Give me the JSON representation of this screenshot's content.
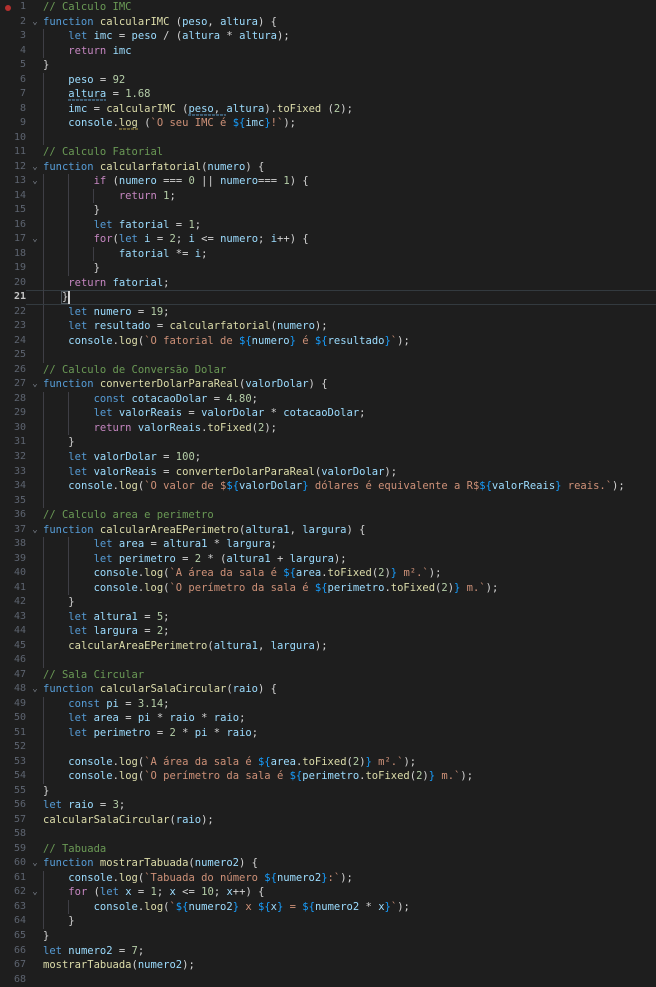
{
  "editor": {
    "language": "javascript",
    "theme": "dark-plus",
    "background_color": "#1e1e1e",
    "active_line": 21,
    "breakpoint_line": 1,
    "total_lines_visible": 68,
    "cursor": {
      "line": 21,
      "column": 6
    }
  },
  "icons": {
    "fold_chevron": "chevron-down-icon",
    "breakpoint": "breakpoint-dot-icon"
  },
  "lines": [
    {
      "n": 1,
      "fold": false,
      "indent_guides": 0,
      "text": "// Calculo IMC"
    },
    {
      "n": 2,
      "fold": true,
      "indent_guides": 0,
      "text": "function calcularIMC (peso, altura) {"
    },
    {
      "n": 3,
      "fold": false,
      "indent_guides": 1,
      "text": "    let imc = peso / (altura * altura);"
    },
    {
      "n": 4,
      "fold": false,
      "indent_guides": 1,
      "text": "    return imc"
    },
    {
      "n": 5,
      "fold": false,
      "indent_guides": 0,
      "text": "}"
    },
    {
      "n": 6,
      "fold": false,
      "indent_guides": 1,
      "text": "    peso = 92"
    },
    {
      "n": 7,
      "fold": false,
      "indent_guides": 1,
      "text": "    altura = 1.68"
    },
    {
      "n": 8,
      "fold": false,
      "indent_guides": 1,
      "text": "    imc = calcularIMC (peso, altura).toFixed (2);"
    },
    {
      "n": 9,
      "fold": false,
      "indent_guides": 1,
      "text": "    console.log (`O seu IMC é ${imc}!`);"
    },
    {
      "n": 10,
      "fold": false,
      "indent_guides": 1,
      "text": ""
    },
    {
      "n": 11,
      "fold": false,
      "indent_guides": 0,
      "text": "// Calculo Fatorial"
    },
    {
      "n": 12,
      "fold": true,
      "indent_guides": 0,
      "text": "function calcularfatorial(numero) {"
    },
    {
      "n": 13,
      "fold": true,
      "indent_guides": 2,
      "text": "        if (numero === 0 || numero=== 1) {"
    },
    {
      "n": 14,
      "fold": false,
      "indent_guides": 3,
      "text": "            return 1;"
    },
    {
      "n": 15,
      "fold": false,
      "indent_guides": 2,
      "text": "        }"
    },
    {
      "n": 16,
      "fold": false,
      "indent_guides": 2,
      "text": "        let fatorial = 1;"
    },
    {
      "n": 17,
      "fold": true,
      "indent_guides": 2,
      "text": "        for(let i = 2; i <= numero; i++) {"
    },
    {
      "n": 18,
      "fold": false,
      "indent_guides": 3,
      "text": "            fatorial *= i;"
    },
    {
      "n": 19,
      "fold": false,
      "indent_guides": 2,
      "text": "        }"
    },
    {
      "n": 20,
      "fold": false,
      "indent_guides": 1,
      "text": "    return fatorial;"
    },
    {
      "n": 21,
      "fold": false,
      "indent_guides": 1,
      "text": "   }"
    },
    {
      "n": 22,
      "fold": false,
      "indent_guides": 1,
      "text": "    let numero = 19;"
    },
    {
      "n": 23,
      "fold": false,
      "indent_guides": 1,
      "text": "    let resultado = calcularfatorial(numero);"
    },
    {
      "n": 24,
      "fold": false,
      "indent_guides": 1,
      "text": "    console.log(`O fatorial de ${numero} é ${resultado}`);"
    },
    {
      "n": 25,
      "fold": false,
      "indent_guides": 1,
      "text": ""
    },
    {
      "n": 26,
      "fold": false,
      "indent_guides": 0,
      "text": "// Calculo de Conversão Dolar"
    },
    {
      "n": 27,
      "fold": true,
      "indent_guides": 0,
      "text": "function converterDolarParaReal(valorDolar) {"
    },
    {
      "n": 28,
      "fold": false,
      "indent_guides": 2,
      "text": "        const cotacaoDolar = 4.80;"
    },
    {
      "n": 29,
      "fold": false,
      "indent_guides": 2,
      "text": "        let valorReais = valorDolar * cotacaoDolar;"
    },
    {
      "n": 30,
      "fold": false,
      "indent_guides": 2,
      "text": "        return valorReais.toFixed(2);"
    },
    {
      "n": 31,
      "fold": false,
      "indent_guides": 1,
      "text": "    }"
    },
    {
      "n": 32,
      "fold": false,
      "indent_guides": 1,
      "text": "    let valorDolar = 100;"
    },
    {
      "n": 33,
      "fold": false,
      "indent_guides": 1,
      "text": "    let valorReais = converterDolarParaReal(valorDolar);"
    },
    {
      "n": 34,
      "fold": false,
      "indent_guides": 1,
      "text": "    console.log(`O valor de $${valorDolar} dólares é equivalente a R$${valorReais} reais.`);"
    },
    {
      "n": 35,
      "fold": false,
      "indent_guides": 1,
      "text": ""
    },
    {
      "n": 36,
      "fold": false,
      "indent_guides": 0,
      "text": "// Calculo area e perimetro"
    },
    {
      "n": 37,
      "fold": true,
      "indent_guides": 0,
      "text": "function calcularAreaEPerimetro(altura1, largura) {"
    },
    {
      "n": 38,
      "fold": false,
      "indent_guides": 2,
      "text": "        let area = altura1 * largura;"
    },
    {
      "n": 39,
      "fold": false,
      "indent_guides": 2,
      "text": "        let perimetro = 2 * (altura1 + largura);"
    },
    {
      "n": 40,
      "fold": false,
      "indent_guides": 2,
      "text": "        console.log(`A área da sala é ${area.toFixed(2)} m².`);"
    },
    {
      "n": 41,
      "fold": false,
      "indent_guides": 2,
      "text": "        console.log(`O perímetro da sala é ${perimetro.toFixed(2)} m.`);"
    },
    {
      "n": 42,
      "fold": false,
      "indent_guides": 1,
      "text": "    }"
    },
    {
      "n": 43,
      "fold": false,
      "indent_guides": 1,
      "text": "    let altura1 = 5;"
    },
    {
      "n": 44,
      "fold": false,
      "indent_guides": 1,
      "text": "    let largura = 2;"
    },
    {
      "n": 45,
      "fold": false,
      "indent_guides": 1,
      "text": "    calcularAreaEPerimetro(altura1, largura);"
    },
    {
      "n": 46,
      "fold": false,
      "indent_guides": 1,
      "text": ""
    },
    {
      "n": 47,
      "fold": false,
      "indent_guides": 0,
      "text": "// Sala Circular"
    },
    {
      "n": 48,
      "fold": true,
      "indent_guides": 0,
      "text": "function calcularSalaCircular(raio) {"
    },
    {
      "n": 49,
      "fold": false,
      "indent_guides": 1,
      "text": "    const pi = 3.14;"
    },
    {
      "n": 50,
      "fold": false,
      "indent_guides": 1,
      "text": "    let area = pi * raio * raio;"
    },
    {
      "n": 51,
      "fold": false,
      "indent_guides": 1,
      "text": "    let perimetro = 2 * pi * raio;"
    },
    {
      "n": 52,
      "fold": false,
      "indent_guides": 1,
      "text": ""
    },
    {
      "n": 53,
      "fold": false,
      "indent_guides": 1,
      "text": "    console.log(`A área da sala é ${area.toFixed(2)} m².`);"
    },
    {
      "n": 54,
      "fold": false,
      "indent_guides": 1,
      "text": "    console.log(`O perímetro da sala é ${perimetro.toFixed(2)} m.`);"
    },
    {
      "n": 55,
      "fold": false,
      "indent_guides": 0,
      "text": "}"
    },
    {
      "n": 56,
      "fold": false,
      "indent_guides": 0,
      "text": "let raio = 3;"
    },
    {
      "n": 57,
      "fold": false,
      "indent_guides": 0,
      "text": "calcularSalaCircular(raio);"
    },
    {
      "n": 58,
      "fold": false,
      "indent_guides": 0,
      "text": ""
    },
    {
      "n": 59,
      "fold": false,
      "indent_guides": 0,
      "text": "// Tabuada"
    },
    {
      "n": 60,
      "fold": true,
      "indent_guides": 0,
      "text": "function mostrarTabuada(numero2) {"
    },
    {
      "n": 61,
      "fold": false,
      "indent_guides": 1,
      "text": "    console.log(`Tabuada do número ${numero2}:`);"
    },
    {
      "n": 62,
      "fold": true,
      "indent_guides": 1,
      "text": "    for (let x = 1; x <= 10; x++) {"
    },
    {
      "n": 63,
      "fold": false,
      "indent_guides": 2,
      "text": "        console.log(`${numero2} x ${x} = ${numero2 * x}`);"
    },
    {
      "n": 64,
      "fold": false,
      "indent_guides": 1,
      "text": "    }"
    },
    {
      "n": 65,
      "fold": false,
      "indent_guides": 0,
      "text": "}"
    },
    {
      "n": 66,
      "fold": false,
      "indent_guides": 0,
      "text": "let numero2 = 7;"
    },
    {
      "n": 67,
      "fold": false,
      "indent_guides": 0,
      "text": "mostrarTabuada(numero2);"
    },
    {
      "n": 68,
      "fold": false,
      "indent_guides": 0,
      "text": ""
    }
  ],
  "colors": {
    "background": "#1e1e1e",
    "comment": "#6a9955",
    "keyword": "#569cd6",
    "control_keyword": "#c586c0",
    "function_name": "#dcdcaa",
    "variable": "#9cdcfe",
    "number": "#b5cea8",
    "string": "#ce9178",
    "punctuation": "#d4d4d4",
    "line_number": "#5d6470",
    "active_line_number": "#c6c6c6",
    "breakpoint": "#b5302e",
    "indent_guide": "#3f3f46"
  }
}
